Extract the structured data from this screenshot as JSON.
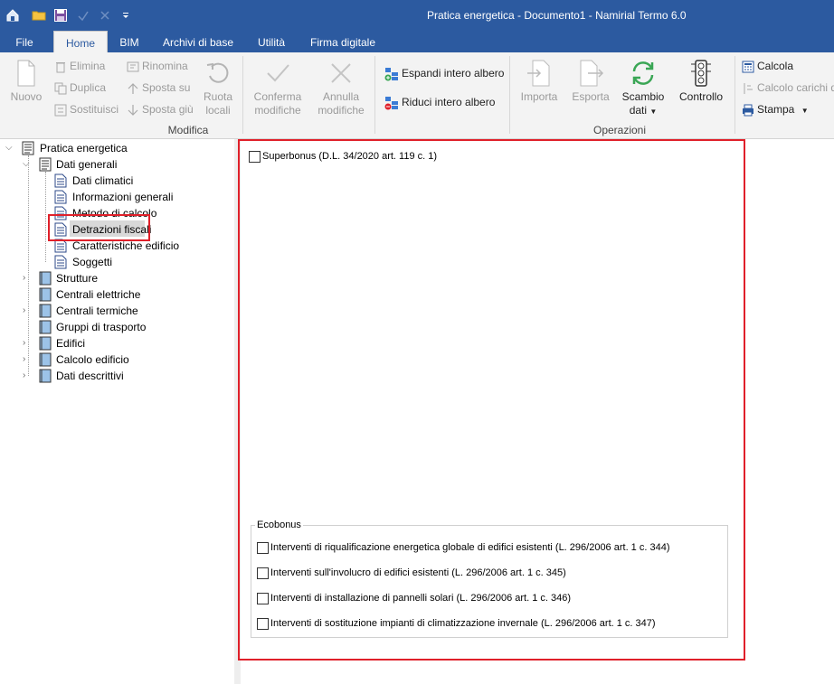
{
  "window": {
    "title": "Pratica energetica - Documento1 - Namirial Termo 6.0"
  },
  "tabs": [
    {
      "label": "File"
    },
    {
      "label": "Home"
    },
    {
      "label": "BIM"
    },
    {
      "label": "Archivi di base"
    },
    {
      "label": "Utilità"
    },
    {
      "label": "Firma digitale"
    }
  ],
  "ribbon": {
    "nuovo": "Nuovo",
    "elimina": "Elimina",
    "duplica": "Duplica",
    "sostituisci": "Sostituisci",
    "rinomina": "Rinomina",
    "sposta_su": "Sposta su",
    "sposta_giu": "Sposta giù",
    "ruota_l1": "Ruota",
    "ruota_l2": "locali",
    "conferma_l1": "Conferma",
    "conferma_l2": "modifiche",
    "annulla_l1": "Annulla",
    "annulla_l2": "modifiche",
    "group_modifica": "Modifica",
    "espandi": "Espandi intero albero",
    "riduci": "Riduci intero albero",
    "importa": "Importa",
    "esporta": "Esporta",
    "scambio_l1": "Scambio",
    "scambio_l2": "dati",
    "controllo": "Controllo",
    "group_operazioni": "Operazioni",
    "calcola": "Calcola",
    "calcolo_carichi": "Calcolo carichi di",
    "stampa": "Stampa"
  },
  "tree": {
    "root": "Pratica energetica",
    "dati_generali": "Dati generali",
    "dati_climatici": "Dati climatici",
    "informazioni_generali": "Informazioni generali",
    "metodo_di_calcolo": "Metodo di calcolo",
    "detrazioni_fiscali": "Detrazioni fiscali",
    "caratteristiche_edificio": "Caratteristiche edificio",
    "soggetti": "Soggetti",
    "strutture": "Strutture",
    "centrali_elettriche": "Centrali elettriche",
    "centrali_termiche": "Centrali termiche",
    "gruppi_di_trasporto": "Gruppi di trasporto",
    "edifici": "Edifici",
    "calcolo_edificio": "Calcolo edificio",
    "dati_descrittivi": "Dati descrittivi"
  },
  "form": {
    "superbonus": "Superbonus (D.L. 34/2020 art. 119 c. 1)",
    "ecobonus_title": "Ecobonus",
    "eco1": "Interventi di riqualificazione energetica globale di edifici esistenti (L. 296/2006 art. 1 c. 344)",
    "eco2": "Interventi sull'involucro di edifici esistenti (L. 296/2006 art. 1 c. 345)",
    "eco3": "Interventi di installazione di pannelli solari (L. 296/2006 art. 1 c. 346)",
    "eco4": "Interventi di sostituzione impianti di climatizzazione invernale (L. 296/2006 art. 1 c. 347)"
  },
  "colors": {
    "title_bar": "#2c5aa0",
    "highlight": "#e0202a",
    "accent_green": "#3aa655"
  }
}
